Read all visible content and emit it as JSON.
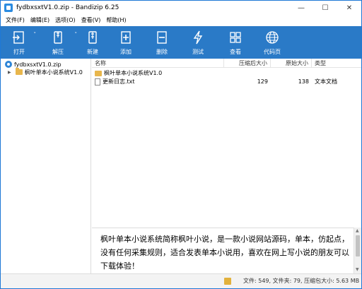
{
  "window": {
    "title": "fydbxsxtV1.0.zip - Bandizip 6.25",
    "controls": {
      "minimize": "—",
      "maximize": "☐",
      "close": "✕"
    }
  },
  "menu": [
    "文件(F)",
    "编辑(E)",
    "选项(O)",
    "查看(V)",
    "帮助(H)"
  ],
  "toolbar": {
    "open": "打开",
    "extract": "解压",
    "new": "新建",
    "add": "添加",
    "delete": "删除",
    "test": "测试",
    "view": "查看",
    "codepage": "代码页"
  },
  "tree": {
    "root": "fydbxsxtV1.0.zip",
    "child": "枫叶单本小说系统V1.0"
  },
  "list": {
    "headers": {
      "name": "名称",
      "compressed": "压缩后大小",
      "original": "原始大小",
      "type": "类型"
    },
    "rows": [
      {
        "name": "枫叶单本小说系统V1.0",
        "compressed": "",
        "original": "",
        "type": ""
      },
      {
        "name": "更新日志.txt",
        "compressed": "129",
        "original": "138",
        "type": "文本文档"
      }
    ]
  },
  "description": {
    "line1": "枫叶单本小说系统简称枫叶小说，是一款小说网站源码，单本，仿起点，",
    "line2": "没有任何采集规则，适合发表单本小说用，喜欢在网上写小说的朋友可以",
    "line3": "下载体验！"
  },
  "status": "文件: 549, 文件夹: 79, 压缩包大小: 5.63 MB"
}
